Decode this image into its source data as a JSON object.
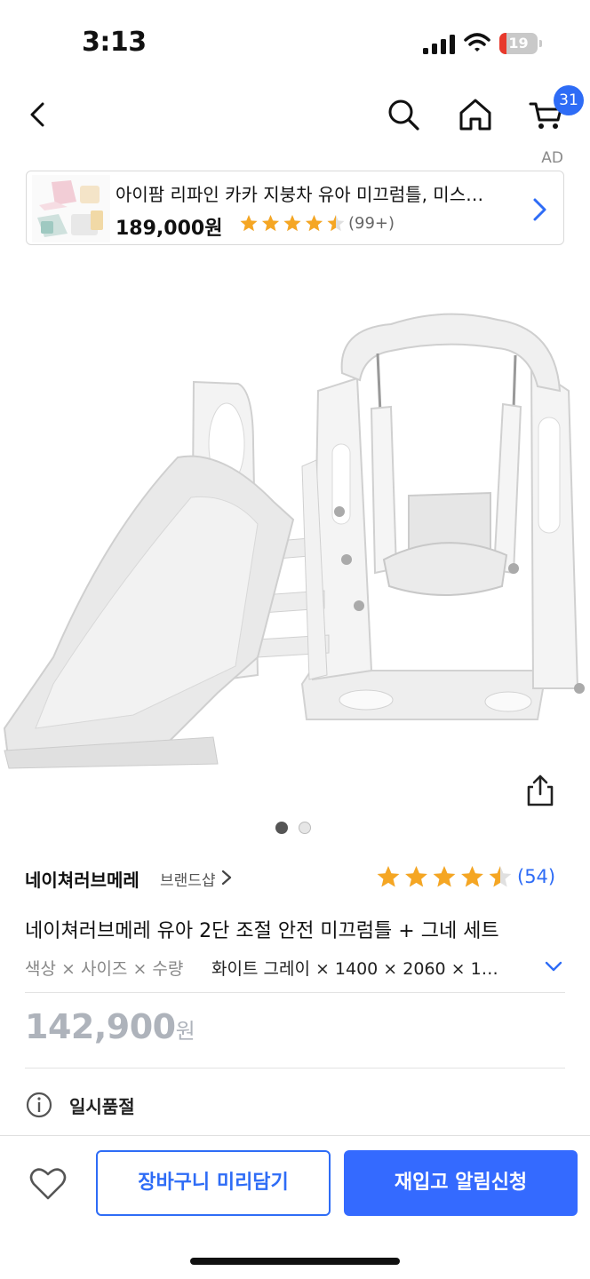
{
  "status_bar": {
    "time": "3:13",
    "battery_level": "19",
    "battery_color": "#e8392c"
  },
  "nav": {
    "back_icon": "chevron-left-icon",
    "search_icon": "search-icon",
    "home_icon": "home-icon",
    "cart_icon": "cart-icon",
    "cart_count": "31"
  },
  "ad": {
    "label": "AD",
    "title": "아이팜 리파인 카카 지붕차 유아 미끄럼틀, 미스…",
    "price": "189,000원",
    "rating": 4.5,
    "review_count": "(99+)"
  },
  "product": {
    "image_count": 2,
    "active_image_index": 0,
    "brand": "네이쳐러브메레",
    "brand_shop_label": "브랜드샵",
    "rating": 4.5,
    "review_count": "(54)",
    "title": "네이쳐러브메레 유아 2단 조절 안전 미끄럼틀 + 그네 세트",
    "option_label": "색상 × 사이즈 × 수량",
    "option_value": "화이트 그레이 × 1400 × 2060 × 1…",
    "price": "142,900",
    "price_unit": "원",
    "status": "일시품절"
  },
  "bottom_bar": {
    "cart_button": "장바구니 미리담기",
    "restock_button": "재입고 알림신청"
  },
  "colors": {
    "accent": "#346aff",
    "star": "#f5a623",
    "price_disabled": "#aeb3bb"
  }
}
